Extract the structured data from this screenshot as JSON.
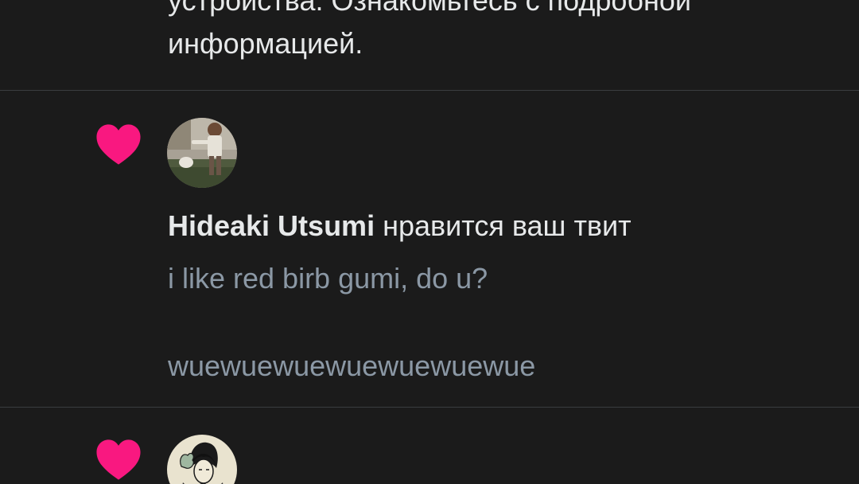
{
  "previous_notification": {
    "text_line1": "устройства. Ознакомьтесь с подробной",
    "text_line2": "информацией."
  },
  "notifications": [
    {
      "icon": "heart-icon",
      "user_name": "Hideaki Utsumi",
      "action": " нравится ваш твит",
      "tweet_lines": [
        "i like red birb gumi, do u?",
        "wuewuewuewuewuewuewue"
      ]
    },
    {
      "icon": "heart-icon"
    }
  ],
  "colors": {
    "background": "#1b1b1b",
    "heart": "#f91880",
    "primary_text": "#e7e9ea",
    "secondary_text": "#8b98a5",
    "divider": "#3a3d40"
  }
}
